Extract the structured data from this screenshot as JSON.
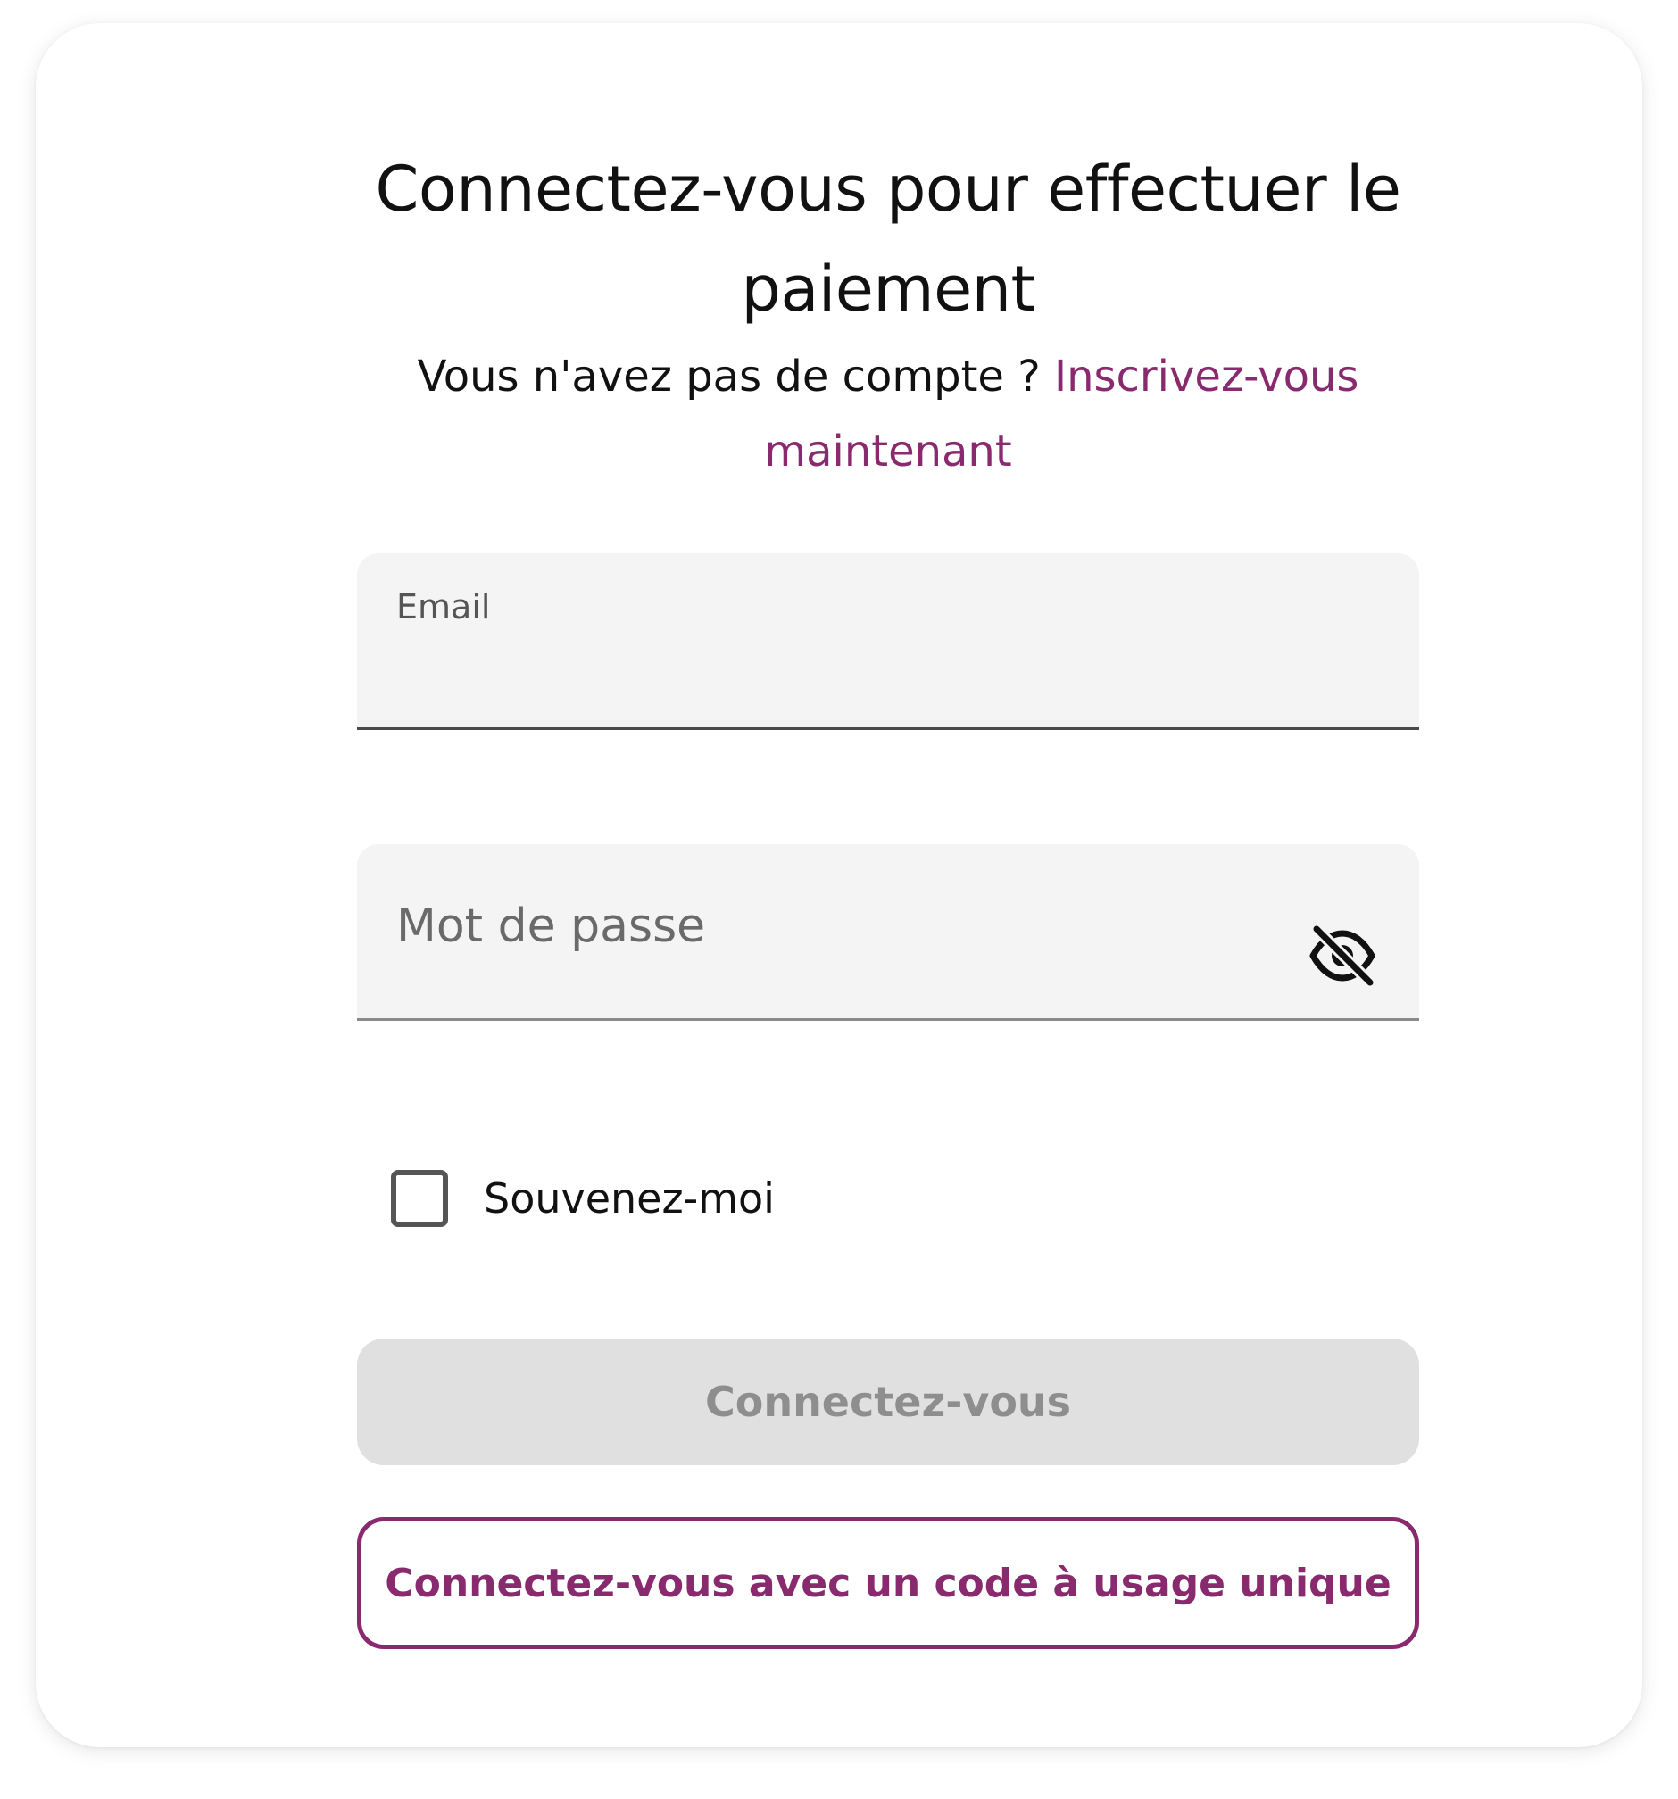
{
  "login": {
    "title": "Connectez-vous pour effectuer le paiement",
    "signup_prompt": "Vous n'avez pas de compte ?",
    "signup_link": "Inscrivez-vous maintenant",
    "email": {
      "label": "Email",
      "value": ""
    },
    "password": {
      "label": "Mot de passe",
      "value": "",
      "toggle_icon": "eye-off-icon"
    },
    "remember_me": {
      "label": "Souvenez-moi",
      "checked": false
    },
    "submit_label": "Connectez-vous",
    "one_time_code_label": "Connectez-vous avec un code à usage unique"
  },
  "colors": {
    "accent": "#8a2a6e",
    "field_bg": "#f4f4f4",
    "disabled_button_bg": "#e0e0e0",
    "disabled_button_text": "#8e8e8e"
  }
}
